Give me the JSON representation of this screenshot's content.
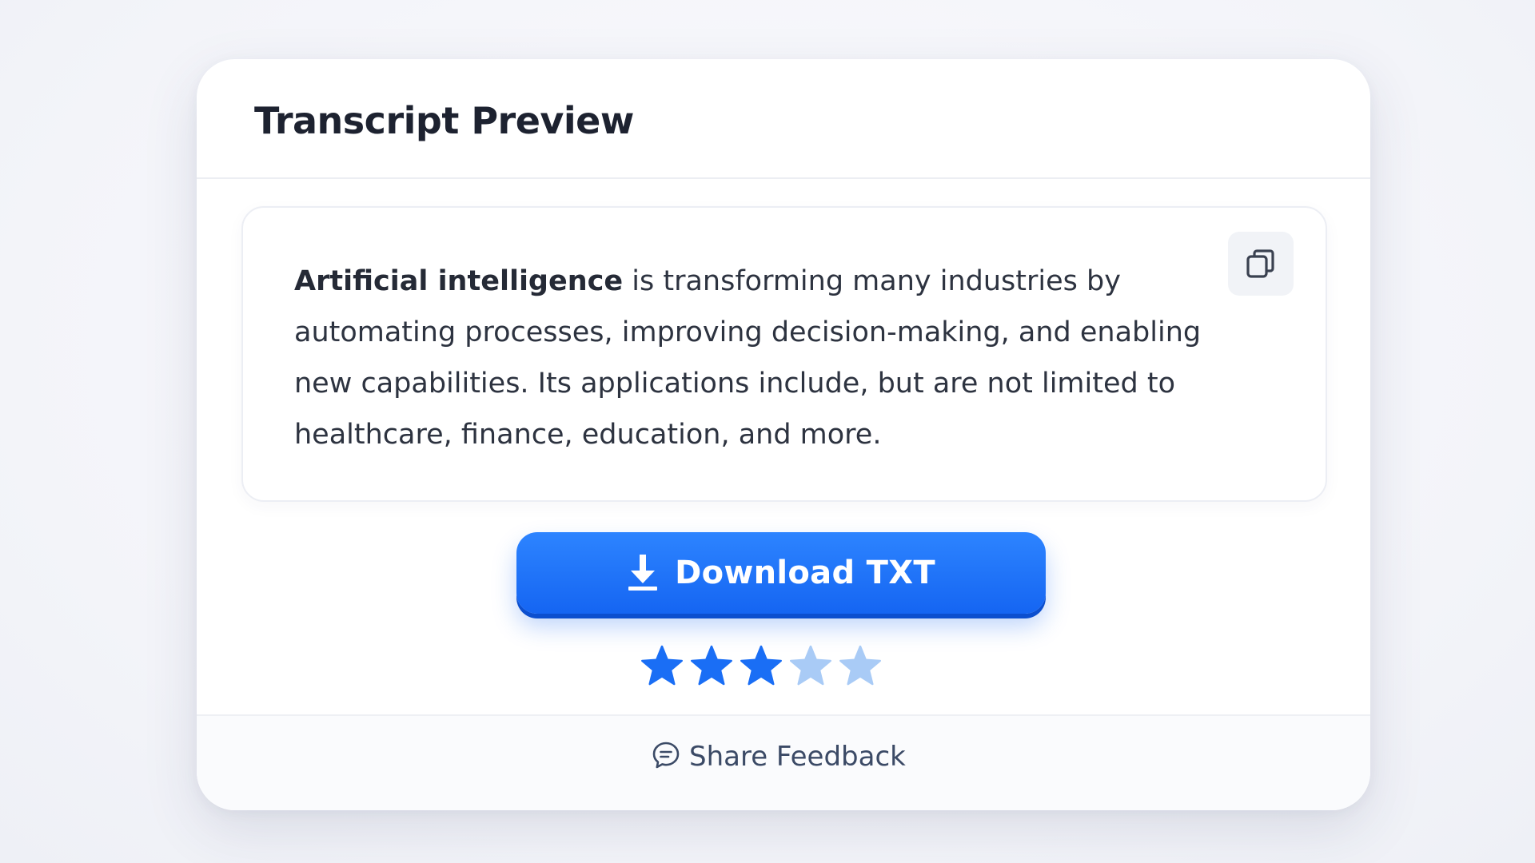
{
  "card": {
    "title": "Transcript Preview"
  },
  "transcript": {
    "highlight": "Artificial intelligence",
    "text": " is transforming many industries by automating processes, improving decision-making, and enabling new capabilities. Its applications include, but are not limited to healthcare, finance, education, and more.",
    "copy_icon": "copy-icon"
  },
  "download": {
    "label": "Download TXT",
    "icon": "download-icon",
    "color": "#1a6ef5"
  },
  "rating": {
    "value": 3,
    "max": 5,
    "filled_color": "#1a6ef5",
    "empty_color": "#a9cbf6"
  },
  "feedback": {
    "label": "Share Feedback",
    "icon": "chat-bubble-icon"
  }
}
